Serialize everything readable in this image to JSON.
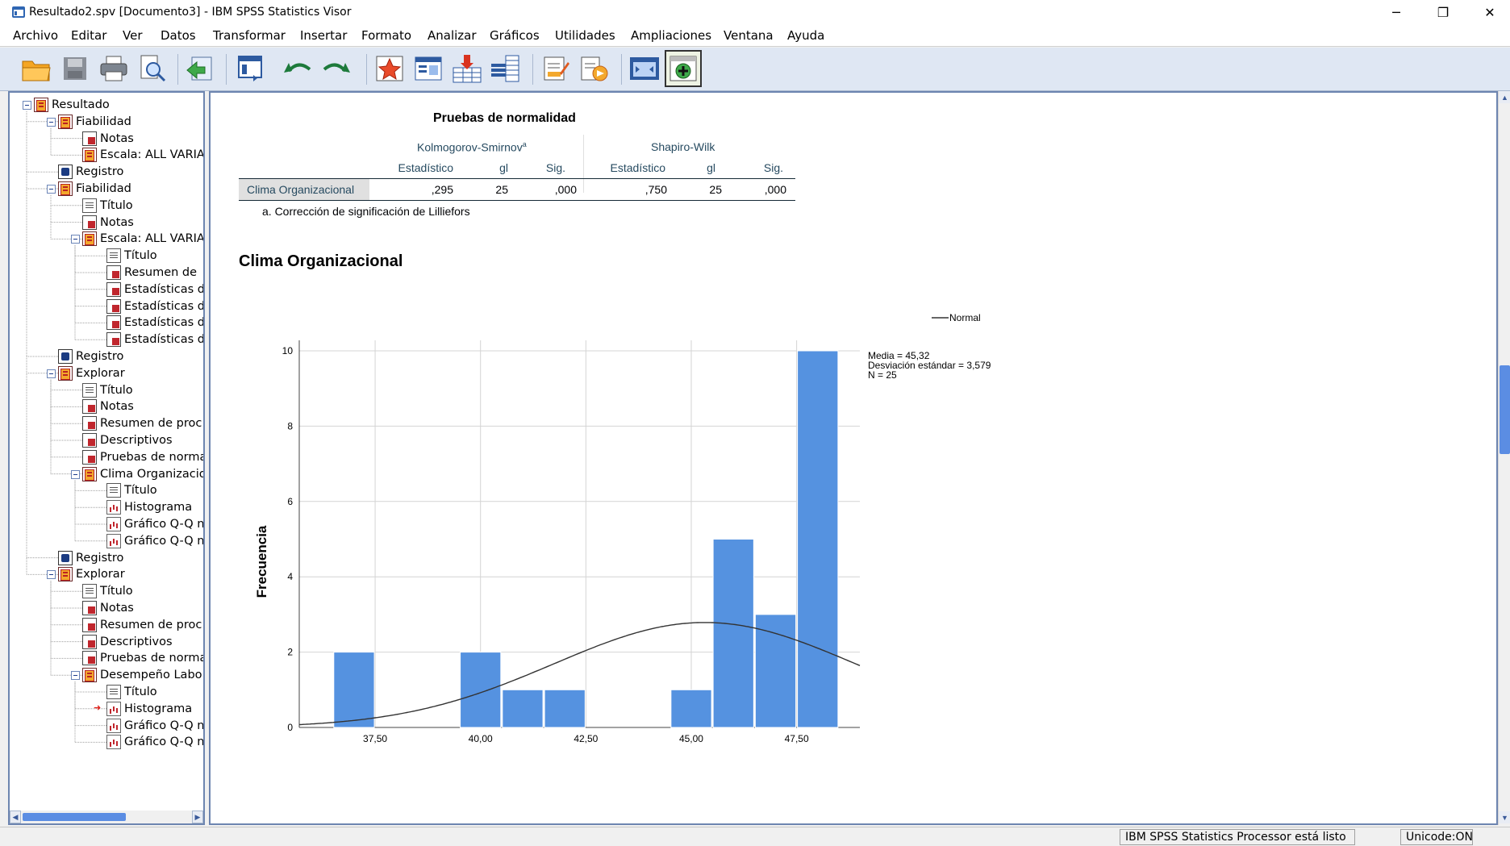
{
  "window": {
    "title": "Resultado2.spv [Documento3] - IBM SPSS Statistics Visor",
    "controls": {
      "minimize": "─",
      "restore": "❐",
      "close": "✕"
    }
  },
  "menu": [
    "Archivo",
    "Editar",
    "Ver",
    "Datos",
    "Transformar",
    "Insertar",
    "Formato",
    "Analizar",
    "Gráficos",
    "Utilidades",
    "Ampliaciones",
    "Ventana",
    "Ayuda"
  ],
  "toolbar": {
    "buttons": [
      "open-folder-icon",
      "save-icon",
      "print-icon",
      "print-preview-icon",
      "export-icon",
      "recall-dialog-icon",
      "undo-icon",
      "redo-icon",
      "goto-data-icon",
      "goto-case-icon",
      "goto-variable-icon",
      "variables-icon",
      "insert-heading-icon",
      "insert-title-icon",
      "show-all-icon",
      "designate-window-icon"
    ]
  },
  "outline": {
    "nodes": [
      {
        "label": "Resultado",
        "level": 0,
        "icon": "book",
        "expander": true
      },
      {
        "label": "Fiabilidad",
        "level": 1,
        "icon": "book",
        "expander": true
      },
      {
        "label": "Notas",
        "level": 2,
        "icon": "note"
      },
      {
        "label": "Escala: ALL VARIA",
        "level": 2,
        "icon": "book"
      },
      {
        "label": "Registro",
        "level": 1,
        "icon": "reg"
      },
      {
        "label": "Fiabilidad",
        "level": 1,
        "icon": "book",
        "expander": true
      },
      {
        "label": "Título",
        "level": 2,
        "icon": "title"
      },
      {
        "label": "Notas",
        "level": 2,
        "icon": "note"
      },
      {
        "label": "Escala: ALL VARIA",
        "level": 2,
        "icon": "book",
        "expander": true
      },
      {
        "label": "Título",
        "level": 3,
        "icon": "title"
      },
      {
        "label": "Resumen de",
        "level": 3,
        "icon": "note"
      },
      {
        "label": "Estadísticas d",
        "level": 3,
        "icon": "note"
      },
      {
        "label": "Estadísticas d",
        "level": 3,
        "icon": "note"
      },
      {
        "label": "Estadísticas d",
        "level": 3,
        "icon": "note"
      },
      {
        "label": "Estadísticas d",
        "level": 3,
        "icon": "note"
      },
      {
        "label": "Registro",
        "level": 1,
        "icon": "reg"
      },
      {
        "label": "Explorar",
        "level": 1,
        "icon": "book",
        "expander": true
      },
      {
        "label": "Título",
        "level": 2,
        "icon": "title"
      },
      {
        "label": "Notas",
        "level": 2,
        "icon": "note"
      },
      {
        "label": "Resumen de proc",
        "level": 2,
        "icon": "note"
      },
      {
        "label": "Descriptivos",
        "level": 2,
        "icon": "note"
      },
      {
        "label": "Pruebas de norma",
        "level": 2,
        "icon": "note"
      },
      {
        "label": "Clima Organizacio",
        "level": 2,
        "icon": "book",
        "expander": true
      },
      {
        "label": "Título",
        "level": 3,
        "icon": "title"
      },
      {
        "label": "Histograma",
        "level": 3,
        "icon": "chart"
      },
      {
        "label": "Gráfico Q-Q n",
        "level": 3,
        "icon": "chart"
      },
      {
        "label": "Gráfico Q-Q n",
        "level": 3,
        "icon": "chart"
      },
      {
        "label": "Registro",
        "level": 1,
        "icon": "reg"
      },
      {
        "label": "Explorar",
        "level": 1,
        "icon": "book",
        "expander": true
      },
      {
        "label": "Título",
        "level": 2,
        "icon": "title"
      },
      {
        "label": "Notas",
        "level": 2,
        "icon": "note"
      },
      {
        "label": "Resumen de proc",
        "level": 2,
        "icon": "note"
      },
      {
        "label": "Descriptivos",
        "level": 2,
        "icon": "note"
      },
      {
        "label": "Pruebas de norma",
        "level": 2,
        "icon": "note"
      },
      {
        "label": "Desempeño Labo",
        "level": 2,
        "icon": "book",
        "expander": true
      },
      {
        "label": "Título",
        "level": 3,
        "icon": "title"
      },
      {
        "label": "Histograma",
        "level": 3,
        "icon": "chart",
        "current": true
      },
      {
        "label": "Gráfico Q-Q n",
        "level": 3,
        "icon": "chart"
      },
      {
        "label": "Gráfico Q-Q n",
        "level": 3,
        "icon": "chart"
      }
    ]
  },
  "table": {
    "title": "Pruebas de normalidad",
    "group1": "Kolmogorov-Smirnov",
    "group1_sup": "a",
    "group2": "Shapiro-Wilk",
    "columns": [
      "Estadístico",
      "gl",
      "Sig.",
      "Estadístico",
      "gl",
      "Sig."
    ],
    "row_label": "Clima Organizacional",
    "row_values": [
      ",295",
      "25",
      ",000",
      ",750",
      "25",
      ",000"
    ],
    "footnote": "a. Corrección de significación de Lilliefors"
  },
  "chart_title": "Clima Organizacional",
  "chart_data": {
    "type": "bar",
    "title": "Clima Organizacional",
    "ylabel": "Frecuencia",
    "xlabel": "",
    "x_ticks": [
      "37,50",
      "40,00",
      "42,50",
      "45,00",
      "47,50"
    ],
    "x_tick_values": [
      37.5,
      40.0,
      42.5,
      45.0,
      47.5
    ],
    "y_ticks": [
      "0",
      "2",
      "4",
      "6",
      "8",
      "10"
    ],
    "ylim": [
      0,
      10
    ],
    "xlim": [
      35.7,
      49.0
    ],
    "bins": [
      {
        "start": 36.5,
        "end": 37.5,
        "value": 2
      },
      {
        "start": 37.5,
        "end": 38.5,
        "value": 0
      },
      {
        "start": 38.5,
        "end": 39.5,
        "value": 0
      },
      {
        "start": 39.5,
        "end": 40.5,
        "value": 2
      },
      {
        "start": 40.5,
        "end": 41.5,
        "value": 1
      },
      {
        "start": 41.5,
        "end": 42.5,
        "value": 1
      },
      {
        "start": 42.5,
        "end": 43.5,
        "value": 0
      },
      {
        "start": 43.5,
        "end": 44.5,
        "value": 0
      },
      {
        "start": 44.5,
        "end": 45.5,
        "value": 1
      },
      {
        "start": 45.5,
        "end": 46.5,
        "value": 5
      },
      {
        "start": 46.5,
        "end": 47.5,
        "value": 3
      },
      {
        "start": 47.5,
        "end": 48.5,
        "value": 10
      }
    ],
    "normal_curve": {
      "mean": 45.32,
      "sd": 3.579,
      "n": 25,
      "bin_width": 1
    },
    "legend": "Normal",
    "stats_text": [
      "Media = 45,32",
      "Desviación estándar = 3,579",
      "N = 25"
    ],
    "grid": true,
    "bar_color": "#5592e0",
    "curve_color": "#333333"
  },
  "status": {
    "processor": "IBM SPSS Statistics Processor está listo",
    "unicode": "Unicode:ON"
  }
}
